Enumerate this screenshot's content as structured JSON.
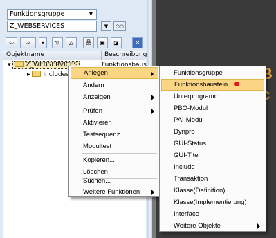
{
  "object_type_select": {
    "value": "Funktionsgruppe"
  },
  "object_name_input": {
    "value": "Z_WEBSERVICES"
  },
  "tree": {
    "columns": [
      "Objektname",
      "Beschreibung"
    ],
    "root": {
      "name": "Z_WEBSERVICES",
      "description": "Funktionsbaustei"
    },
    "child": {
      "name": "Includes"
    }
  },
  "context_menu": [
    {
      "label": "Anlegen",
      "active": true,
      "submenu": true
    },
    {
      "label": "Ändern"
    },
    {
      "label": "Anzeigen",
      "submenu": true
    },
    {
      "label": "Prüfen",
      "submenu": true
    },
    {
      "label": "Aktivieren"
    },
    {
      "label": "Testsequenz..."
    },
    {
      "label": "Modultest"
    },
    {
      "label": "Kopieren..."
    },
    {
      "label": "Löschen"
    },
    {
      "label": "Suchen..."
    },
    {
      "label": "Weitere Funktionen",
      "submenu": true
    }
  ],
  "submenu": [
    {
      "label": "Funktionsgruppe"
    },
    {
      "label": "Funktionsbaustein",
      "active": true,
      "marker": "red-dot"
    },
    {
      "label": "Unterprogramm"
    },
    {
      "label": "PBO-Modul"
    },
    {
      "label": "PAI-Modul"
    },
    {
      "label": "Dynpro"
    },
    {
      "label": "GUI-Status"
    },
    {
      "label": "GUI-Titel"
    },
    {
      "label": "Include"
    },
    {
      "label": "Transaktion"
    },
    {
      "label": "Klasse(Definition)"
    },
    {
      "label": "Klasse(Implementierung)"
    },
    {
      "label": "Interface"
    },
    {
      "label": "Weitere Objekte",
      "submenu": true
    }
  ],
  "colors": {
    "menu_highlight": "#fad583",
    "panel": "#dfe8f5",
    "dark_area": "#3a3a3a",
    "marker": "#e51b13"
  }
}
